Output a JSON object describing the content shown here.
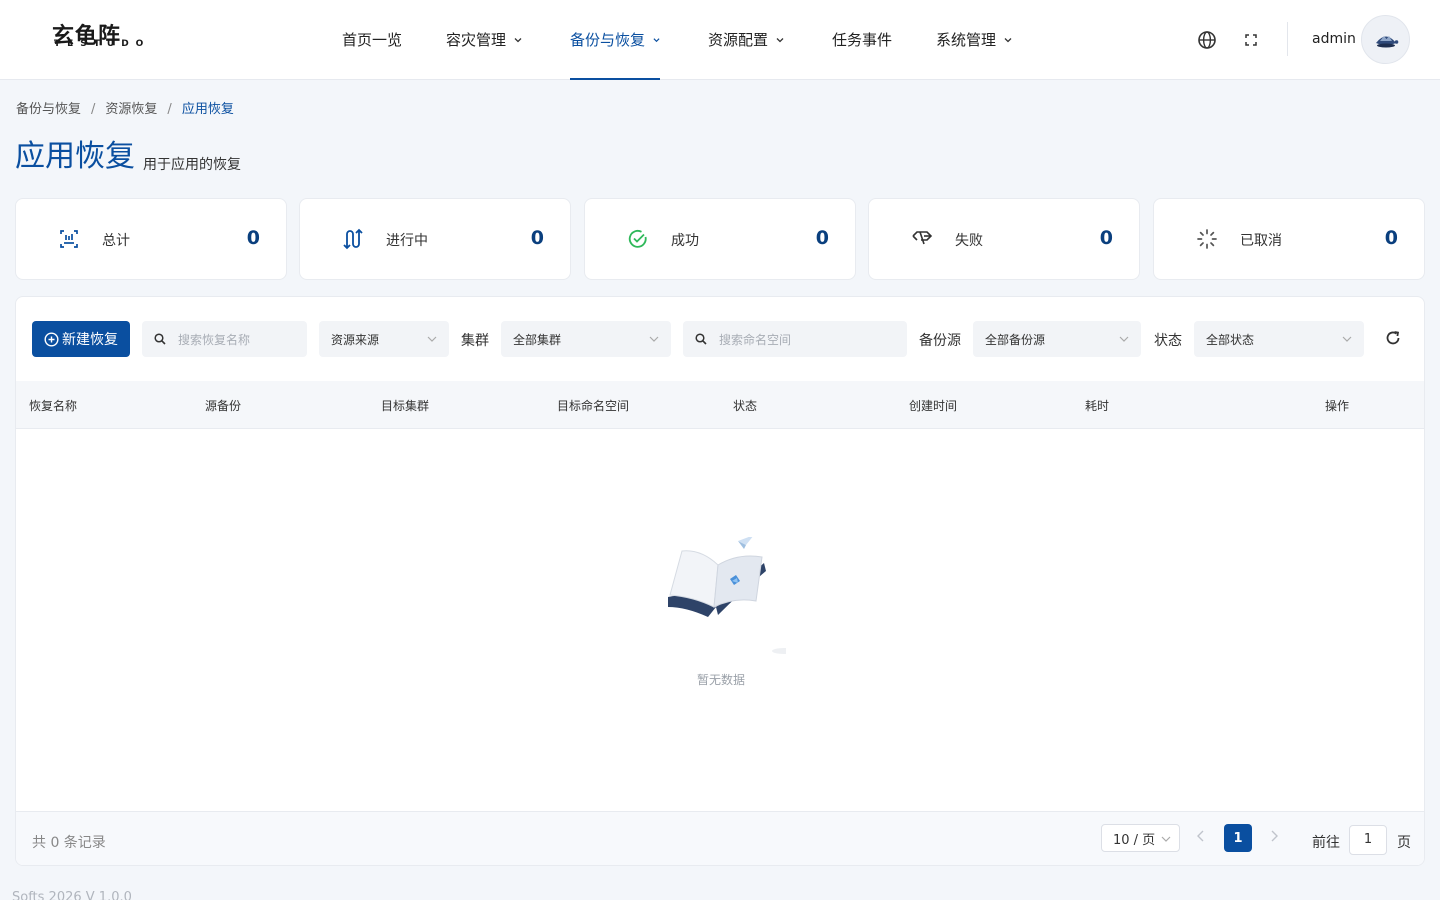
{
  "header": {
    "logo_cn": "玄龟阵",
    "logo_en": "TESTUDO",
    "nav": [
      {
        "label": "首页一览",
        "has_caret": false,
        "active": false
      },
      {
        "label": "容灾管理",
        "has_caret": true,
        "active": false
      },
      {
        "label": "备份与恢复",
        "has_caret": true,
        "active": true
      },
      {
        "label": "资源配置",
        "has_caret": true,
        "active": false
      },
      {
        "label": "任务事件",
        "has_caret": false,
        "active": false
      },
      {
        "label": "系统管理",
        "has_caret": true,
        "active": false
      }
    ],
    "icons": [
      "globe-icon",
      "fullscreen-icon"
    ],
    "username": "admin"
  },
  "breadcrumb": [
    "备份与恢复",
    "资源恢复",
    "应用恢复"
  ],
  "page": {
    "title": "应用恢复",
    "subtitle": "用于应用的恢复"
  },
  "stats": [
    {
      "label": "总计",
      "value": "0",
      "icon": "total-icon",
      "color": "#0a4fa0"
    },
    {
      "label": "进行中",
      "value": "0",
      "icon": "in-progress-icon",
      "color": "#0a4fa0"
    },
    {
      "label": "成功",
      "value": "0",
      "icon": "success-icon",
      "color": "#2fb85a"
    },
    {
      "label": "失败",
      "value": "0",
      "icon": "failed-icon",
      "color": "#333333"
    },
    {
      "label": "已取消",
      "value": "0",
      "icon": "cancelled-icon",
      "color": "#555555"
    }
  ],
  "toolbar": {
    "new_button": "新建恢复",
    "search_name_placeholder": "搜索恢复名称",
    "source_select": "资源来源",
    "cluster_label": "集群",
    "cluster_select": "全部集群",
    "namespace_placeholder": "搜索命名空间",
    "backup_source_label": "备份源",
    "backup_source_select": "全部备份源",
    "status_label": "状态",
    "status_select": "全部状态"
  },
  "table": {
    "columns": [
      "恢复名称",
      "源备份",
      "目标集群",
      "目标命名空间",
      "状态",
      "创建时间",
      "耗时",
      "操作"
    ],
    "rows": [],
    "empty_text": "暂无数据"
  },
  "pagination": {
    "total_text": "共 0 条记录",
    "page_size": "10 / 页",
    "current_page": "1",
    "goto_prefix": "前往",
    "goto_value": "1",
    "goto_suffix": "页"
  },
  "footer": {
    "version": "Softs 2026 V 1.0.0"
  },
  "colors": {
    "primary": "#0a4fa0",
    "background": "#f3f6fa",
    "success": "#2fb85a"
  }
}
